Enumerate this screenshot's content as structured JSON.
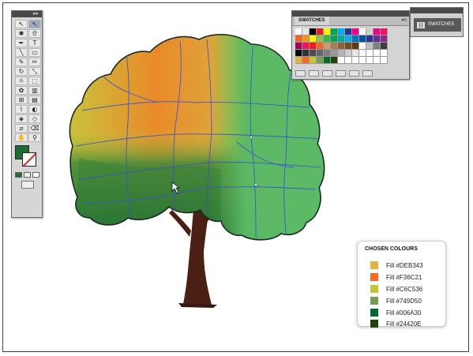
{
  "tools_panel": {
    "tools": [
      {
        "name": "selection-tool-icon",
        "glyph": "↖"
      },
      {
        "name": "direct-selection-tool-icon",
        "glyph": "↖"
      },
      {
        "name": "magic-wand-tool-icon",
        "glyph": "✱"
      },
      {
        "name": "lasso-tool-icon",
        "glyph": "ᘓ"
      },
      {
        "name": "pen-tool-icon",
        "glyph": "✒"
      },
      {
        "name": "type-tool-icon",
        "glyph": "T"
      },
      {
        "name": "line-segment-tool-icon",
        "glyph": "╲"
      },
      {
        "name": "rectangle-tool-icon",
        "glyph": "▭"
      },
      {
        "name": "paintbrush-tool-icon",
        "glyph": "✎"
      },
      {
        "name": "pencil-tool-icon",
        "glyph": "✏"
      },
      {
        "name": "rotate-tool-icon",
        "glyph": "↻"
      },
      {
        "name": "scale-tool-icon",
        "glyph": "⤡"
      },
      {
        "name": "warp-tool-icon",
        "glyph": "☼"
      },
      {
        "name": "free-transform-tool-icon",
        "glyph": "⬚"
      },
      {
        "name": "symbol-sprayer-tool-icon",
        "glyph": "✿"
      },
      {
        "name": "column-graph-tool-icon",
        "glyph": "▥"
      },
      {
        "name": "mesh-tool-icon",
        "glyph": "⊞"
      },
      {
        "name": "gradient-tool-icon",
        "glyph": "▤"
      },
      {
        "name": "eyedropper-tool-icon",
        "glyph": "⌇"
      },
      {
        "name": "blend-tool-icon",
        "glyph": "◐"
      },
      {
        "name": "live-paint-bucket-tool-icon",
        "glyph": "◈"
      },
      {
        "name": "live-paint-selection-tool-icon",
        "glyph": "◇"
      },
      {
        "name": "slice-tool-icon",
        "glyph": "⧄"
      },
      {
        "name": "eraser-tool-icon",
        "glyph": "⌫"
      },
      {
        "name": "hand-tool-icon",
        "glyph": "✋"
      },
      {
        "name": "zoom-tool-icon",
        "glyph": "⚲"
      }
    ],
    "fill_color": "#1E6B34"
  },
  "swatches_panel": {
    "tab_label": "SWATCHES",
    "rows": [
      [
        "#FFFFFF",
        "#E8E8E8",
        "#000000",
        "#ED1C24",
        "#FFF200",
        "#00A651",
        "#00AEEF",
        "#2E3192",
        "#EC008C",
        "#FFFFFF",
        "#D0D0D0",
        "#EC008C",
        "#ED145B"
      ],
      [
        "#F26522",
        "#F7941D",
        "#FFF200",
        "#8DC63F",
        "#39B54A",
        "#00A651",
        "#00A99D",
        "#00AEEF",
        "#0072BC",
        "#0054A6",
        "#2E3192",
        "#662D91",
        "#92278F"
      ],
      [
        "#9E005D",
        "#ED145B",
        "#ED1C24",
        "#F26522",
        "#C69C6D",
        "#A67C52",
        "#8C6239",
        "#754C24",
        "#603913",
        "#FFFFFF",
        "#C0C0C0",
        "#808080",
        "#404040"
      ],
      [
        "#000000",
        "#333333",
        "#4D4D4D",
        "#666666",
        "#808080",
        "#999999",
        "#B3B3B3",
        "#CCCCCC",
        "#E6E6E6",
        "#FFFFFF",
        "#FFFFFF",
        "#FFFFFF",
        "#FFFFFF"
      ],
      [
        "#DEB343",
        "#F36C21",
        "#C6C536",
        "#749D50",
        "#006A30",
        "#24420E",
        "#FFFFFF",
        "#FFFFFF",
        "#FFFFFF",
        "#FFFFFF",
        "#FFFFFF",
        "#FFFFFF",
        "#FFFFFF"
      ]
    ]
  },
  "collapsed_dock": {
    "label": "SWATCHES"
  },
  "chosen_colours": {
    "title": "CHOSEN COLOURS",
    "items": [
      {
        "label": "Fill  #DEB343",
        "color": "#DEB343"
      },
      {
        "label": "Fill  #F36C21",
        "color": "#F36C21"
      },
      {
        "label": "Fill  #C6C536",
        "color": "#C6C536"
      },
      {
        "label": "Fill  #749D50",
        "color": "#749D50"
      },
      {
        "label": "Fill  #006A30",
        "color": "#006A30"
      },
      {
        "label": "Fill  #24420E",
        "color": "#24420E"
      }
    ]
  },
  "artwork": {
    "trunk_color": "#4A1F14",
    "path_color": "#3A55C8"
  }
}
